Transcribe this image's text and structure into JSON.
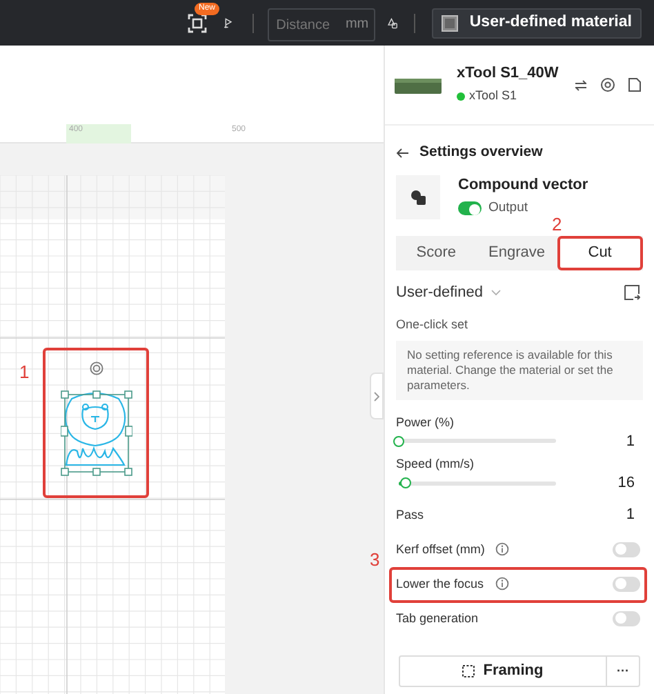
{
  "toolbar": {
    "new_badge": "New",
    "distance": {
      "placeholder": "Distance",
      "unit": "mm"
    },
    "material_button": "User-defined material"
  },
  "canvas": {
    "ruler_labels": [
      "400",
      "500"
    ],
    "annotations": [
      {
        "label": "1"
      }
    ]
  },
  "device": {
    "name": "xTool S1_40W",
    "model": "xTool S1",
    "connected": true
  },
  "panel": {
    "back_label": "Settings overview",
    "layer": {
      "title": "Compound vector",
      "output_label": "Output",
      "output_on": true
    },
    "annotation_2": "2",
    "tabs": [
      {
        "label": "Score",
        "selected": false
      },
      {
        "label": "Engrave",
        "selected": false
      },
      {
        "label": "Cut",
        "selected": true
      }
    ],
    "preset": "User-defined",
    "one_click_label": "One-click set",
    "notice": "No setting reference is available for this material. Change the material or set the parameters.",
    "settings": [
      {
        "kind": "slider",
        "label": "Power (%)",
        "level": 0.0,
        "value": "1"
      },
      {
        "kind": "slider",
        "label": "Speed (mm/s)",
        "level": 0.04,
        "value": "16"
      },
      {
        "kind": "value",
        "label": "Pass",
        "value": "1"
      },
      {
        "kind": "toggle",
        "label": "Kerf offset (mm)",
        "info": true,
        "on": false
      },
      {
        "kind": "toggle",
        "label": "Lower the focus",
        "info": true,
        "on": false,
        "annotation": "3"
      },
      {
        "kind": "toggle",
        "label": "Tab generation",
        "info": false,
        "on": false
      }
    ],
    "framing_button": "Framing",
    "more_button": "···"
  }
}
